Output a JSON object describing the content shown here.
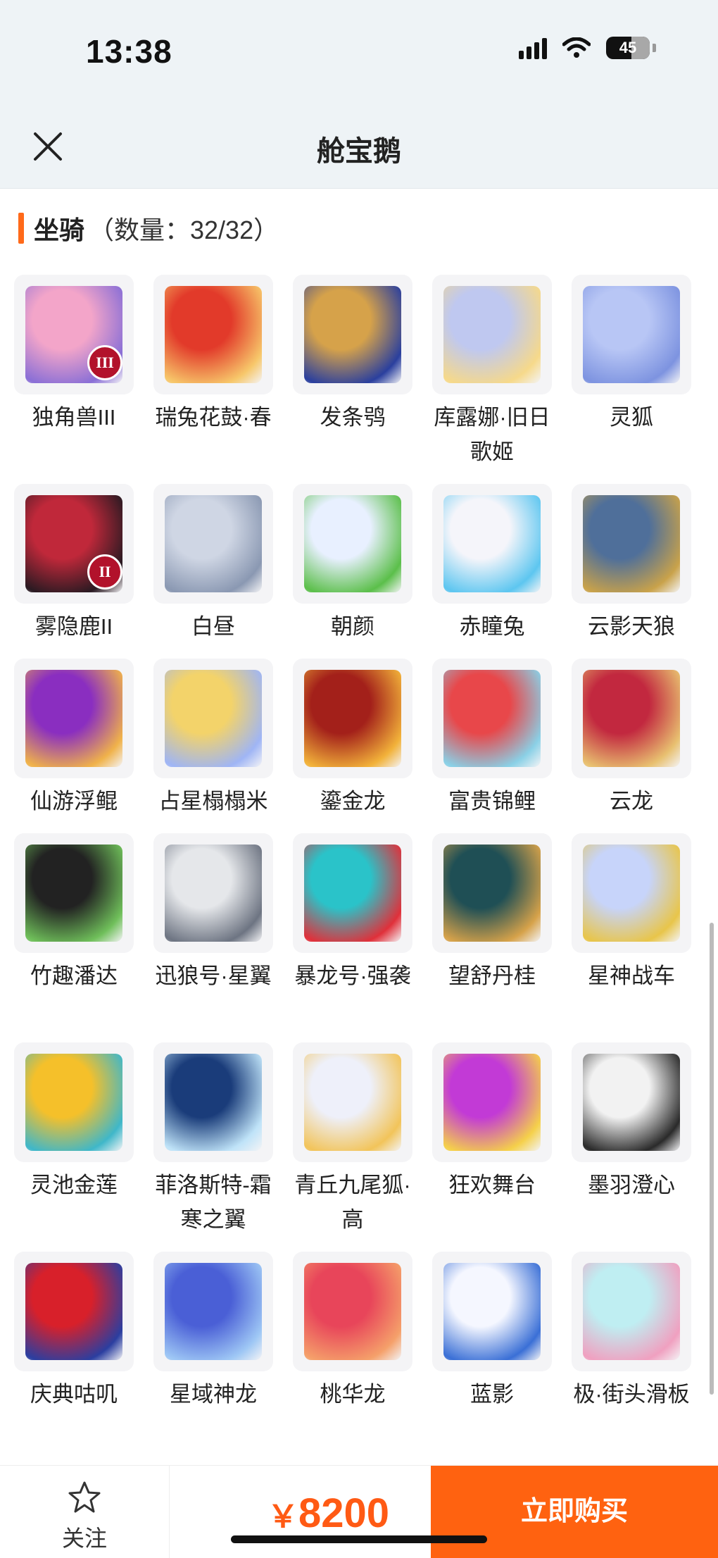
{
  "status_bar": {
    "time": "13:38",
    "battery": "45"
  },
  "header": {
    "title": "舱宝鹅"
  },
  "section": {
    "name": "坐骑",
    "count": "（数量：32/32）"
  },
  "items": [
    {
      "name": "独角兽III",
      "badge": "III",
      "colors": [
        "#f3a5c9",
        "#8a6fd6"
      ]
    },
    {
      "name": "瑞兔花鼓·春",
      "colors": [
        "#e23a2a",
        "#f7c76a"
      ]
    },
    {
      "name": "发条鸮",
      "colors": [
        "#d6a24a",
        "#2a3f9e"
      ]
    },
    {
      "name": "库露娜·旧日歌姬",
      "colors": [
        "#bfc8f0",
        "#f6d98a"
      ]
    },
    {
      "name": "灵狐",
      "colors": [
        "#b8c6f5",
        "#7d93e0"
      ]
    },
    {
      "name": "雾隐鹿II",
      "badge": "II",
      "colors": [
        "#c0283a",
        "#2a1a22"
      ]
    },
    {
      "name": "白昼",
      "colors": [
        "#cfd6e4",
        "#8a98b2"
      ]
    },
    {
      "name": "朝颜",
      "colors": [
        "#e8f0ff",
        "#5bbf4a"
      ]
    },
    {
      "name": "赤瞳兔",
      "colors": [
        "#f5f5fa",
        "#5dc6f0"
      ]
    },
    {
      "name": "云影天狼",
      "colors": [
        "#4f6f9a",
        "#c9a24a"
      ]
    },
    {
      "name": "仙游浮鲲",
      "colors": [
        "#8a2ec0",
        "#f0b24a"
      ]
    },
    {
      "name": "占星榻榻米",
      "colors": [
        "#f3d36a",
        "#9fb5f5"
      ]
    },
    {
      "name": "鎏金龙",
      "colors": [
        "#a3201a",
        "#f2b23a"
      ]
    },
    {
      "name": "富贵锦鲤",
      "colors": [
        "#e8474a",
        "#8ad0e6"
      ]
    },
    {
      "name": "云龙",
      "colors": [
        "#c2283f",
        "#e8c070"
      ]
    },
    {
      "name": "竹趣潘达",
      "colors": [
        "#222222",
        "#6fbf5a"
      ]
    },
    {
      "name": "迅狼号·星翼",
      "colors": [
        "#e5e7ea",
        "#6d7482"
      ]
    },
    {
      "name": "暴龙号·强袭",
      "colors": [
        "#2ac3c9",
        "#e0303a"
      ]
    },
    {
      "name": "望舒丹桂",
      "colors": [
        "#1f4f55",
        "#d6a24a"
      ]
    },
    {
      "name": "星神战车",
      "colors": [
        "#c7d4fa",
        "#e8c54a"
      ]
    },
    {
      "name": "灵池金莲",
      "colors": [
        "#f5c02a",
        "#3fb7c9"
      ]
    },
    {
      "name": "菲洛斯特-霜寒之翼",
      "colors": [
        "#1a3c7a",
        "#bfe3f8"
      ]
    },
    {
      "name": "青丘九尾狐·高",
      "colors": [
        "#eef0fa",
        "#f2c45a"
      ]
    },
    {
      "name": "狂欢舞台",
      "colors": [
        "#c23ad6",
        "#f5d04a"
      ]
    },
    {
      "name": "墨羽澄心",
      "colors": [
        "#f2f2f2",
        "#2a2a2a"
      ]
    },
    {
      "name": "庆典咕叽",
      "colors": [
        "#d8202a",
        "#2b3ea0"
      ]
    },
    {
      "name": "星域神龙",
      "colors": [
        "#4a5fd6",
        "#9ec7f5"
      ]
    },
    {
      "name": "桃华龙",
      "colors": [
        "#e8455a",
        "#f5a06a"
      ]
    },
    {
      "name": "蓝影",
      "colors": [
        "#f5f7ff",
        "#3a6fd6"
      ]
    },
    {
      "name": "极·街头滑板",
      "colors": [
        "#bfeef2",
        "#f0a0c0"
      ]
    }
  ],
  "bottom_bar": {
    "follow_label": "关注",
    "currency": "￥",
    "price": "8200",
    "buy_label": "立即购买"
  }
}
